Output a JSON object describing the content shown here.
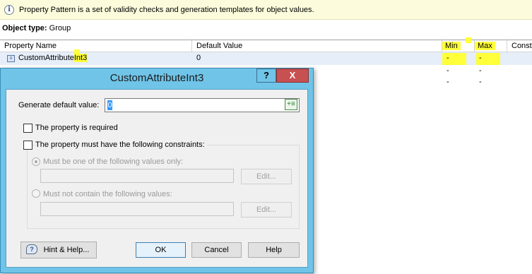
{
  "infobar": {
    "icon": "info-icon",
    "message": "Property Pattern is a set of validity checks and generation templates for object values."
  },
  "object_type": {
    "label": "Object type:",
    "value": "Group"
  },
  "grid": {
    "columns": {
      "property_name": "Property Name",
      "default_value": "Default Value",
      "min": "Min",
      "max": "Max",
      "constraints": "Constr"
    },
    "row1": {
      "name_prefix": "CustomAttribute",
      "name_suffix": "Int3",
      "default": "0",
      "min": "-",
      "max": "-"
    },
    "row2": {
      "min": "-",
      "max": "-"
    },
    "row3": {
      "min": "-",
      "max": "-"
    }
  },
  "highlight_color": "#ffff3a",
  "dialog": {
    "title": "CustomAttributeInt3",
    "help_glyph": "?",
    "close_glyph": "X",
    "generate_default_label": "Generate default value:",
    "generate_default_value": "0",
    "required_label": "The property is required",
    "constraints_label": "The property must have the following constraints:",
    "one_of_label": "Must be one of the following values only:",
    "edit_label": "Edit...",
    "not_contain_label": "Must not contain the following values:",
    "hint_label": "Hint & Help...",
    "ok_label": "OK",
    "cancel_label": "Cancel",
    "help_label": "Help"
  },
  "colors": {
    "title_bar": "#6fc4e8",
    "close_button": "#c75050",
    "info_bar": "#fcfcdc"
  }
}
